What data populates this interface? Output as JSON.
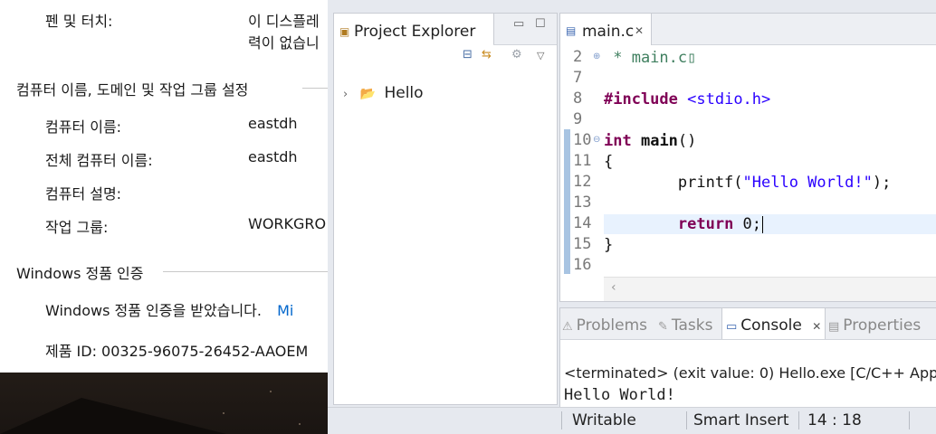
{
  "system_properties": {
    "pen_touch": {
      "label": "펜 및 터치:",
      "value_line1": "이 디스플레",
      "value_line2": "력이 없습니"
    },
    "computer_section": {
      "title": "컴퓨터 이름, 도메인 및 작업 그룹 설정"
    },
    "rows": [
      {
        "label": "컴퓨터 이름:",
        "value": "eastdh"
      },
      {
        "label": "전체 컴퓨터 이름:",
        "value": "eastdh"
      },
      {
        "label": "컴퓨터 설명:",
        "value": ""
      },
      {
        "label": "작업 그룹:",
        "value": "WORKGRO"
      }
    ],
    "activation_section": {
      "title": "Windows 정품 인증"
    },
    "activation_status": "Windows 정품 인증을 받았습니다.",
    "activation_link": "Mi",
    "product_id": "제품 ID: 00325-96075-26452-AAOEM"
  },
  "eclipse": {
    "project_explorer": {
      "tab_title": "Project Explorer",
      "tree": [
        {
          "label": "Hello",
          "expanded": false
        }
      ]
    },
    "editor": {
      "tab_title": "main.c",
      "lines": [
        {
          "num": "2",
          "fold": "plus",
          "segments": [
            {
              "t": " * main.c",
              "c": "cmt"
            },
            {
              "t": "▯",
              "c": "cmt"
            }
          ]
        },
        {
          "num": "7",
          "segments": []
        },
        {
          "num": "8",
          "segments": [
            {
              "t": "#include",
              "c": "kw"
            },
            {
              "t": " ",
              "c": ""
            },
            {
              "t": "<stdio.h>",
              "c": "str"
            }
          ]
        },
        {
          "num": "9",
          "segments": []
        },
        {
          "num": "10",
          "fold": "minus",
          "segments": [
            {
              "t": "int",
              "c": "kw"
            },
            {
              "t": " ",
              "c": ""
            },
            {
              "t": "main",
              "c": "bold"
            },
            {
              "t": "()",
              "c": ""
            }
          ]
        },
        {
          "num": "11",
          "segments": [
            {
              "t": "{",
              "c": ""
            }
          ]
        },
        {
          "num": "12",
          "segments": [
            {
              "t": "        printf(",
              "c": ""
            },
            {
              "t": "\"Hello World!\"",
              "c": "str"
            },
            {
              "t": ");",
              "c": ""
            }
          ]
        },
        {
          "num": "13",
          "segments": []
        },
        {
          "num": "14",
          "current": true,
          "segments": [
            {
              "t": "        ",
              "c": ""
            },
            {
              "t": "return",
              "c": "kw"
            },
            {
              "t": " 0;",
              "c": ""
            }
          ]
        },
        {
          "num": "15",
          "segments": [
            {
              "t": "}",
              "c": ""
            }
          ]
        },
        {
          "num": "16",
          "segments": []
        }
      ]
    },
    "bottom_panel": {
      "tabs": [
        {
          "label": "Problems",
          "active": false
        },
        {
          "label": "Tasks",
          "active": false
        },
        {
          "label": "Console",
          "active": true
        },
        {
          "label": "Properties",
          "active": false
        }
      ],
      "console_header": "<terminated> (exit value: 0) Hello.exe [C/C++ App",
      "console_output": "Hello World!"
    },
    "status_bar": {
      "mode": "Writable",
      "insert": "Smart Insert",
      "position": "14 : 18"
    }
  }
}
